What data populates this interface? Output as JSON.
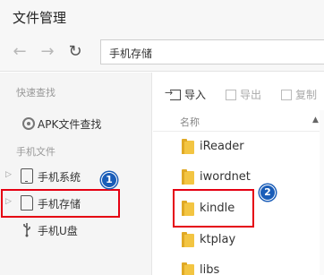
{
  "window": {
    "title": "文件管理"
  },
  "nav": {
    "back_icon": "←",
    "forward_icon": "→",
    "refresh_icon": "↻",
    "path": "手机存储"
  },
  "sidebar": {
    "quick_label": "快速查找",
    "quick_items": [
      {
        "label": "APK文件查找",
        "icon": "radio-icon"
      }
    ],
    "phone_label": "手机文件",
    "items": [
      {
        "label": "手机系统",
        "icon": "phone-icon",
        "expandable": true
      },
      {
        "label": "手机存储",
        "icon": "sd-card-icon",
        "expandable": true,
        "highlighted": true
      },
      {
        "label": "手机U盘",
        "icon": "usb-icon",
        "expandable": false
      }
    ]
  },
  "toolbar": {
    "import_label": "导入",
    "export_label": "导出",
    "copy_label": "复制"
  },
  "list": {
    "column_name": "名称",
    "sort_icon": "▲",
    "rows": [
      "iReader",
      "iwordnet",
      "kindle",
      "ktplay",
      "libs"
    ]
  },
  "annotations": {
    "badge1": "1",
    "badge2": "2"
  },
  "colors": {
    "highlight": "#e50012",
    "badge": "#1a5db8",
    "folder": "#f3c542"
  }
}
